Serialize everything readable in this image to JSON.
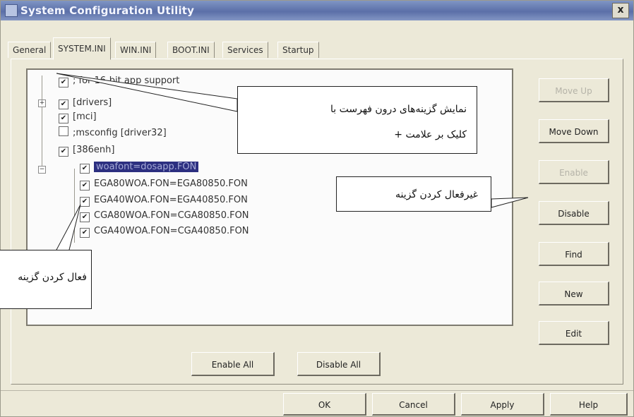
{
  "window": {
    "title": "System Configuration Utility",
    "close_label": "x"
  },
  "tabs": [
    {
      "label": "General"
    },
    {
      "label": "SYSTEM.INI",
      "active": true
    },
    {
      "label": "WIN.INI"
    },
    {
      "label": "BOOT.INI"
    },
    {
      "label": "Services"
    },
    {
      "label": "Startup"
    }
  ],
  "tree": {
    "items": [
      {
        "label": "; for 16-bit app support",
        "checked": true
      },
      {
        "label": "[drivers]",
        "checked": true,
        "expander": "+"
      },
      {
        "label": "[mci]",
        "checked": true
      },
      {
        "label": ";msconfig [driver32]",
        "checked": false
      },
      {
        "label": "[386enh]",
        "checked": true,
        "expander": "−"
      },
      {
        "label": "woafont=dosapp.FON",
        "checked": true,
        "selected": true
      },
      {
        "label": "EGA80WOA.FON=EGA80850.FON",
        "checked": true
      },
      {
        "label": "EGA40WOA.FON=EGA40850.FON",
        "checked": true
      },
      {
        "label": "CGA80WOA.FON=CGA80850.FON",
        "checked": true
      },
      {
        "label": "CGA40WOA.FON=CGA40850.FON",
        "checked": true
      }
    ]
  },
  "side_buttons": {
    "move_up": "Move Up",
    "move_down": "Move Down",
    "enable": "Enable",
    "disable": "Disable",
    "find": "Find",
    "new": "New",
    "edit": "Edit"
  },
  "list_buttons": {
    "enable_all": "Enable All",
    "disable_all": "Disable All"
  },
  "dialog_buttons": {
    "ok": "OK",
    "cancel": "Cancel",
    "apply": "Apply",
    "help": "Help"
  },
  "callouts": {
    "expand_line1": "نمایش گزینه‌های درون فهرست با",
    "expand_line2": "کلیک بر علامت +",
    "disable_option": "غیرفعال کردن گزینه",
    "enable_option": "فعال کردن گزینه"
  }
}
